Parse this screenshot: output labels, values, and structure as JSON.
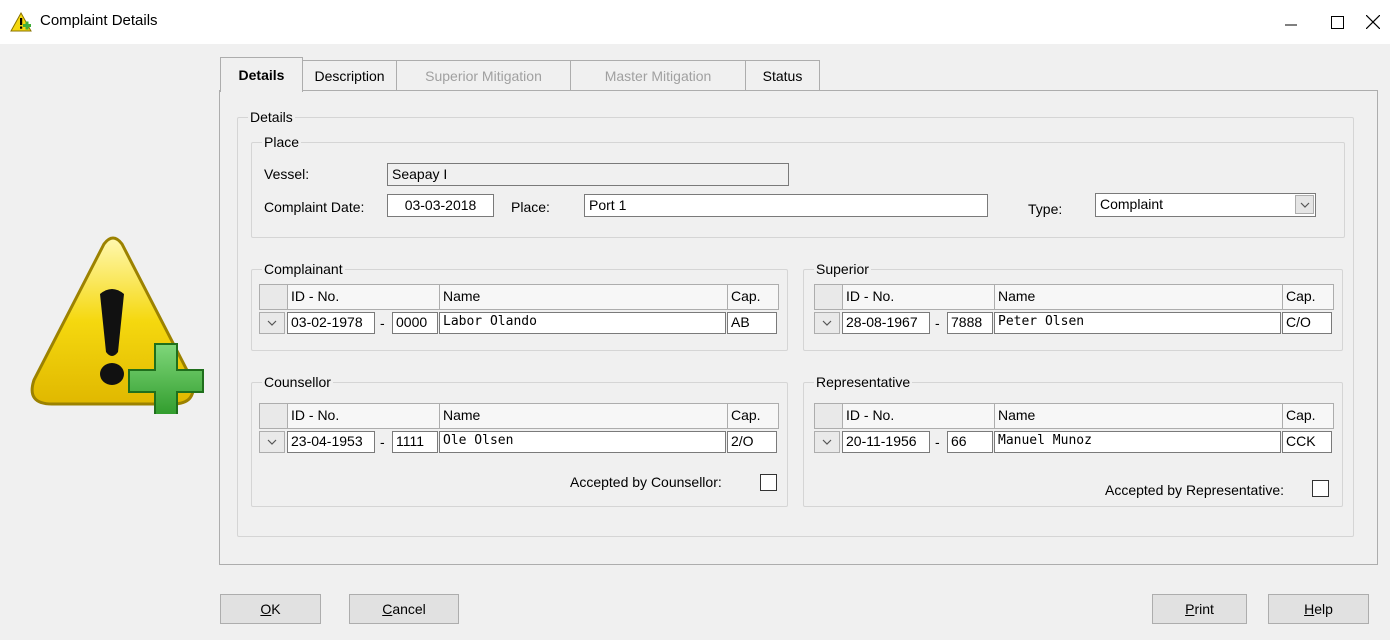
{
  "window": {
    "title": "Complaint Details"
  },
  "tabs": [
    {
      "label": "Details",
      "state": "active"
    },
    {
      "label": "Description",
      "state": "normal"
    },
    {
      "label": "Superior Mitigation",
      "state": "disabled"
    },
    {
      "label": "Master Mitigation",
      "state": "disabled"
    },
    {
      "label": "Status",
      "state": "normal"
    }
  ],
  "details": {
    "group_label": "Details",
    "place": {
      "group_label": "Place",
      "vessel_label": "Vessel:",
      "vessel_value": "Seapay I",
      "date_label": "Complaint Date:",
      "date_value": "03-03-2018",
      "place_label": "Place:",
      "place_value": "Port 1",
      "type_label": "Type:",
      "type_value": "Complaint"
    },
    "columns": {
      "id": "ID - No.",
      "name": "Name",
      "cap": "Cap."
    },
    "complainant": {
      "label": "Complainant",
      "date": "03-02-1978",
      "number": "0000",
      "name": "Labor Olando",
      "cap": "AB"
    },
    "superior": {
      "label": "Superior",
      "date": "28-08-1967",
      "number": "7888",
      "name": "Peter Olsen",
      "cap": "C/O"
    },
    "counsellor": {
      "label": "Counsellor",
      "date": "23-04-1953",
      "number": "1111",
      "name": "Ole Olsen",
      "cap": "2/O",
      "accepted_label": "Accepted by Counsellor:",
      "accepted": false
    },
    "representative": {
      "label": "Representative",
      "date": "20-11-1956",
      "number": "66",
      "name": "Manuel Munoz",
      "cap": "CCK",
      "accepted_label": "Accepted by Representative:",
      "accepted": false
    }
  },
  "buttons": {
    "ok_mnemonic": "O",
    "ok_rest": "K",
    "cancel_mnemonic": "C",
    "cancel_rest": "ancel",
    "print_mnemonic": "P",
    "print_rest": "rint",
    "help_mnemonic": "H",
    "help_rest": "elp"
  },
  "colors": {
    "warning_yellow": "#f5d80f",
    "plus_green": "#3fae3a"
  },
  "icons": [
    "warning-icon",
    "minimize-icon",
    "maximize-icon",
    "close-icon",
    "warning-add-icon",
    "chevron-down-icon"
  ]
}
